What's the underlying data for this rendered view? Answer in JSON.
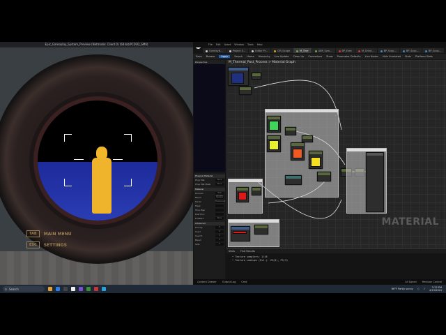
{
  "game": {
    "title": "Epic_Gameplay_System_Preview (Netmode: Client 0) (64-bit/PCD3D_SM6)",
    "hud": [
      {
        "key": "TAB",
        "label": "MAIN MENU"
      },
      {
        "key": "ESC",
        "label": "SETTINGS"
      }
    ]
  },
  "editor": {
    "menu": [
      "File",
      "Edit",
      "Asset",
      "Window",
      "Tools",
      "Help"
    ],
    "tabs": [
      {
        "label": "OverlayN...",
        "dot": "#cccccc"
      },
      {
        "label": "Project S...",
        "dot": "#cccccc"
      },
      {
        "label": "Editor Pr...",
        "dot": "#cccccc"
      },
      {
        "label": "CM_Scope",
        "dot": "#d4a020"
      },
      {
        "label": "M_Ther",
        "dot": "#6aa84f",
        "active": true
      },
      {
        "label": "ABP_Sym...",
        "dot": "#6aa84f"
      },
      {
        "label": "BP_Exec",
        "dot": "#cc3333"
      },
      {
        "label": "M_Grind...",
        "dot": "#cc3333"
      },
      {
        "label": "BP_Scop...",
        "dot": "#3d85c6"
      },
      {
        "label": "BP_Scop...",
        "dot": "#3d85c6"
      },
      {
        "label": "BP_Scop...",
        "dot": "#3d85c6"
      }
    ],
    "toolbar": [
      "Save",
      "Browse",
      "Apply",
      "Search",
      "Home",
      "Hierarchy",
      "Live Update",
      "Clean Up",
      "Connectors",
      "Show",
      "Parameter Defaults",
      "Live Nodes",
      "Hide Unrelated",
      "Stats",
      "Platform Stats"
    ],
    "viewport_label": "Perspective",
    "details_sections": [
      {
        "head": "Physical Material",
        "rows": [
          [
            "Phys Mat",
            "None"
          ],
          [
            "Phys Mat Mask",
            "None"
          ]
        ]
      },
      {
        "head": "Material",
        "rows": [
          [
            "Domain",
            "Post Process"
          ],
          [
            "Blend",
            "Opaque"
          ],
          [
            "Decal",
            "Translucent"
          ],
          [
            "Mask",
            ""
          ],
          [
            "Tone Map",
            ""
          ],
          [
            "Post Proc",
            ""
          ],
          [
            "Enabled",
            "None"
          ]
        ]
      },
      {
        "head": "Advanced",
        "rows": [
          [
            "Priority",
            "0"
          ],
          [
            "Used",
            "0"
          ],
          [
            "Used S",
            "0"
          ],
          [
            "Blend",
            "0"
          ],
          [
            "Sets",
            "0"
          ]
        ]
      }
    ],
    "breadcrumb": "M_Thermal_Post_Process > Material Graph",
    "watermark": "MATERIAL",
    "bottom_tabs": [
      "Stats",
      "Find Results"
    ],
    "log": [
      "• Texture samplers: 1/16",
      "• Texture Lookups (Est.): VS(0), PS(3)"
    ],
    "status": [
      "Content Drawer",
      "Output Log",
      "Cmd"
    ],
    "status_right": [
      "All Saved",
      "Revision Control"
    ]
  },
  "taskbar": {
    "search_placeholder": "Search",
    "weather": "66°F Partly sunny",
    "time": "2:22 PM",
    "date": "4/13/2024"
  },
  "colors": {
    "thermal_figure": "#f2b62a",
    "thermal_floor": "#2a3db3",
    "swatch_green": "#3ed55a",
    "swatch_yellow": "#e8f030",
    "swatch_orange": "#f05a20",
    "swatch_yellow2": "#f4e020",
    "swatch_red": "#e01818",
    "swatch_blue": "#203080"
  }
}
